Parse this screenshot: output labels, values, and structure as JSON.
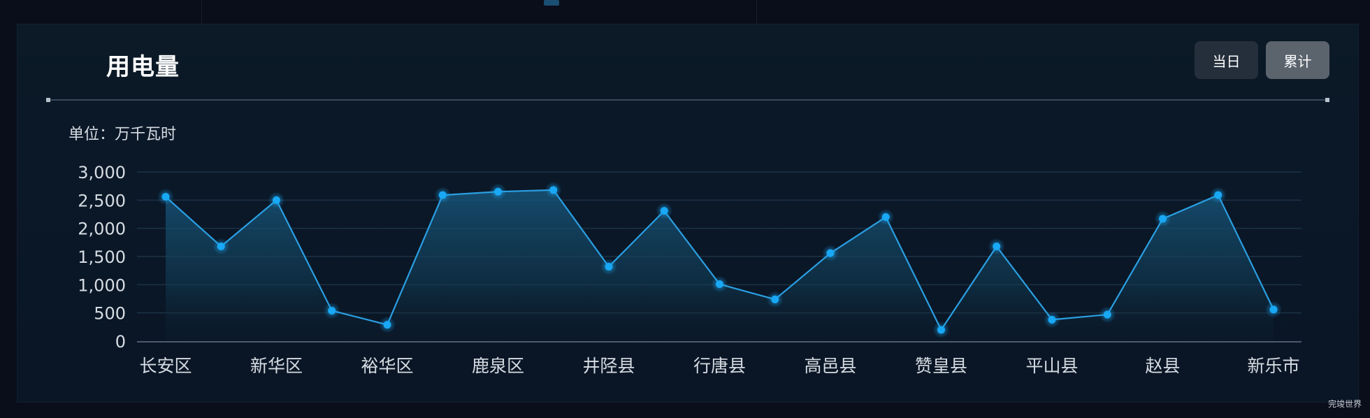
{
  "panel": {
    "title": "用电量",
    "unit_label": "单位：万千瓦时",
    "buttons": [
      {
        "label": "当日",
        "active": false
      },
      {
        "label": "累计",
        "active": true
      }
    ]
  },
  "watermark": "完竣世界",
  "colors": {
    "line": "#2a9fe2",
    "point": "#18a8f5",
    "area_top": "#17557a",
    "grid": "#1c3345",
    "axis": "#4a5b6c",
    "tick_text": "#d6dce2"
  },
  "chart_data": {
    "type": "area",
    "title": "用电量",
    "ylabel": "单位：万千瓦时",
    "xlabel": "",
    "categories": [
      "长安区",
      "",
      "新华区",
      "",
      "裕华区",
      "",
      "鹿泉区",
      "",
      "井陉县",
      "",
      "行唐县",
      "",
      "高邑县",
      "",
      "赞皇县",
      "",
      "平山县",
      "",
      "赵县",
      "",
      "新乐市"
    ],
    "x_tick_labels": [
      "长安区",
      "新华区",
      "裕华区",
      "鹿泉区",
      "井陉县",
      "行唐县",
      "高邑县",
      "赞皇县",
      "平山县",
      "赵县",
      "新乐市"
    ],
    "series": [
      {
        "name": "用电量",
        "values": [
          2560,
          1680,
          2500,
          540,
          290,
          2590,
          2650,
          2680,
          1320,
          2310,
          1010,
          740,
          1560,
          2200,
          200,
          1680,
          380,
          470,
          2170,
          2590,
          560
        ]
      }
    ],
    "ylim": [
      0,
      3000
    ],
    "y_ticks": [
      0,
      500,
      1000,
      1500,
      2000,
      2500,
      3000
    ],
    "y_tick_labels": [
      "0",
      "500",
      "1,000",
      "1,500",
      "2,000",
      "2,500",
      "3,000"
    ],
    "grid": true,
    "legend": "none"
  }
}
